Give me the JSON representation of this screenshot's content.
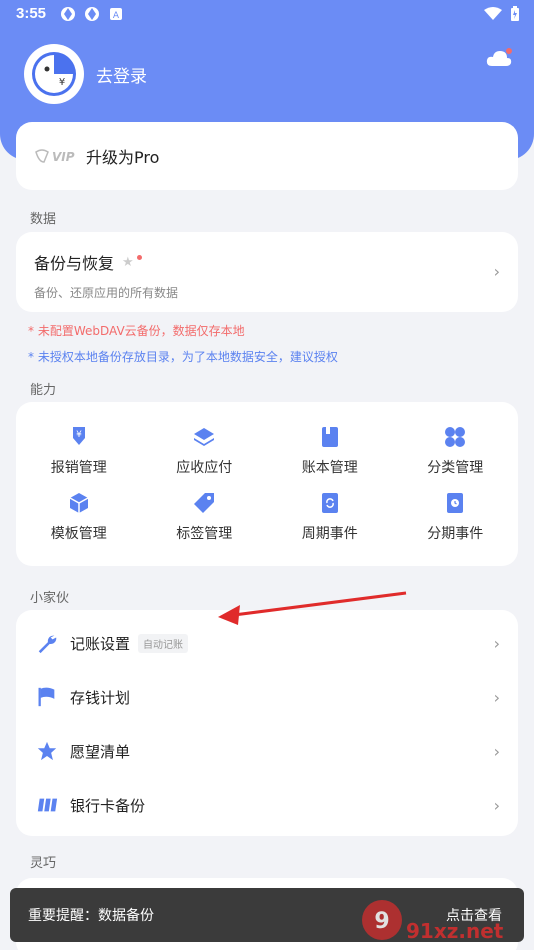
{
  "status_bar": {
    "time": "3:55"
  },
  "profile": {
    "login_label": "去登录"
  },
  "pro": {
    "label": "升级为Pro",
    "logo_text": "VIP"
  },
  "sections": {
    "data": "数据",
    "capability": "能力",
    "tools": "小家伙",
    "lingqiao": "灵巧"
  },
  "backup": {
    "title": "备份与恢复",
    "subtitle": "备份、还原应用的所有数据"
  },
  "notices": {
    "webdav": "* 未配置WebDAV云备份，数据仅存本地",
    "authorize": "* 未授权本地备份存放目录，为了本地数据安全，建议授权"
  },
  "features": [
    {
      "label": "报销管理",
      "icon": "reimburse-icon"
    },
    {
      "label": "应收应付",
      "icon": "layers-icon"
    },
    {
      "label": "账本管理",
      "icon": "book-icon"
    },
    {
      "label": "分类管理",
      "icon": "category-icon"
    },
    {
      "label": "模板管理",
      "icon": "cube-icon"
    },
    {
      "label": "标签管理",
      "icon": "tag-icon"
    },
    {
      "label": "周期事件",
      "icon": "cycle-icon"
    },
    {
      "label": "分期事件",
      "icon": "installment-icon"
    }
  ],
  "tools": [
    {
      "label": "记账设置",
      "tag": "自动记账",
      "icon": "wrench-icon"
    },
    {
      "label": "存钱计划",
      "icon": "flag-icon"
    },
    {
      "label": "愿望清单",
      "icon": "star-icon"
    },
    {
      "label": "银行卡备份",
      "icon": "card-icon"
    }
  ],
  "toast": {
    "message": "重要提醒：数据备份",
    "action": "点击查看"
  },
  "watermark": {
    "text": "91xz.net"
  },
  "colors": {
    "accent": "#6b8cf5",
    "red": "#f36b6b",
    "blue": "#5b82f0"
  }
}
